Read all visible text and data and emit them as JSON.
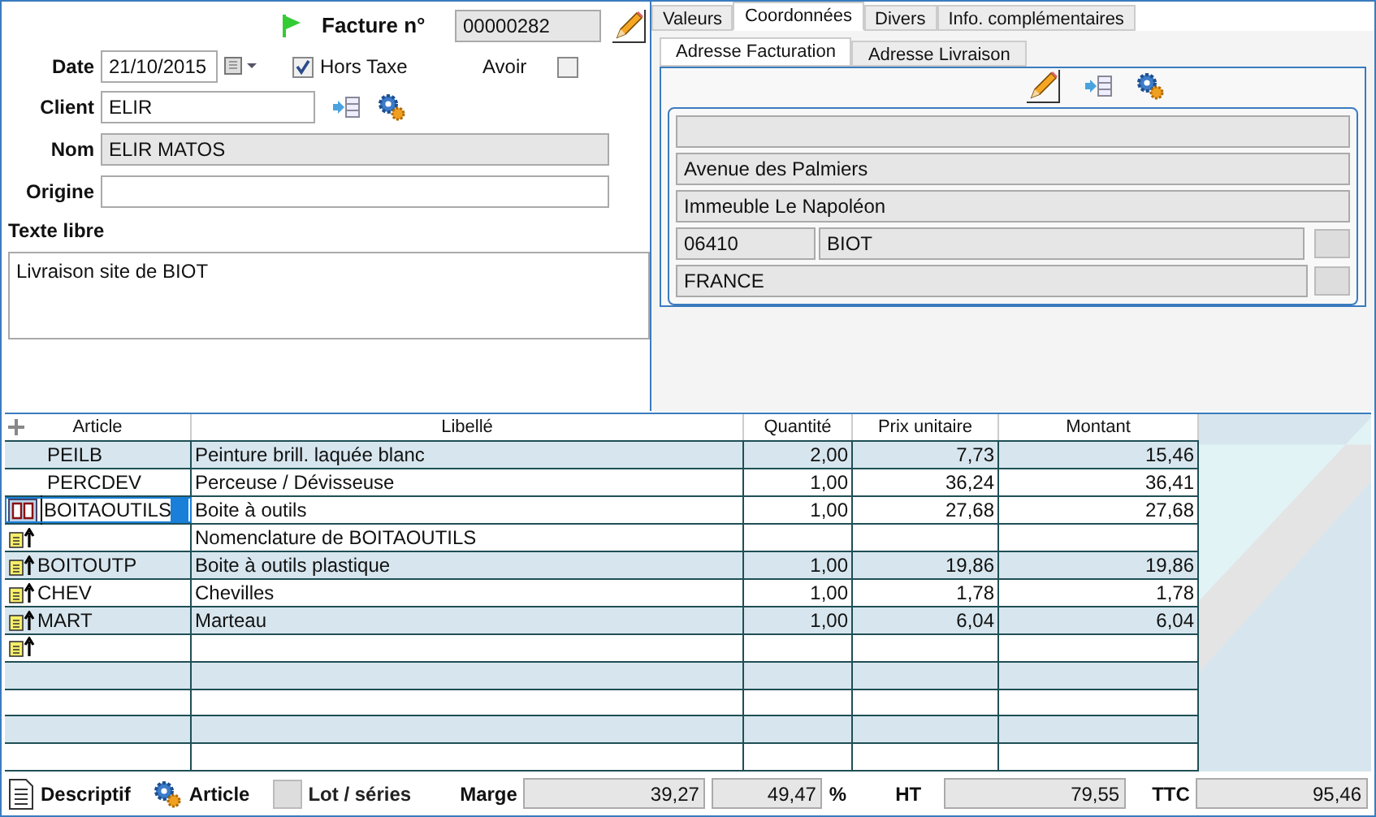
{
  "header": {
    "invoice_label": "Facture n°",
    "invoice_number": "00000282",
    "date_label": "Date",
    "date": "21/10/2015",
    "hors_taxe": {
      "label": "Hors Taxe",
      "checked": true
    },
    "avoir": {
      "label": "Avoir",
      "checked": false
    },
    "client_label": "Client",
    "client": "ELIR",
    "nom_label": "Nom",
    "nom": "ELIR MATOS",
    "origine_label": "Origine",
    "texte_label": "Texte libre",
    "texte": "Livraison site de BIOT"
  },
  "tabs": [
    {
      "label": "Valeurs",
      "selected": false
    },
    {
      "label": "Coordonnées",
      "selected": true
    },
    {
      "label": "Divers",
      "selected": false
    },
    {
      "label": "Info. complémentaires",
      "selected": false
    }
  ],
  "subtabs": [
    {
      "label": "Adresse Facturation",
      "selected": true
    },
    {
      "label": "Adresse Livraison",
      "selected": false
    }
  ],
  "address": {
    "line_2": "Avenue des Palmiers",
    "line_3": "Immeuble Le Napoléon",
    "postcode": "06410",
    "city": "BIOT",
    "country": "FRANCE"
  },
  "table": {
    "columns": [
      "Article",
      "Libellé",
      "Quantité",
      "Prix unitaire",
      "Montant"
    ],
    "rows": [
      {
        "kind": "line",
        "selected": false,
        "article": "PEILB",
        "libelle": "Peinture brill. laquée blanc",
        "quantite": "2,00",
        "prix": "7,73",
        "montant": "15,46"
      },
      {
        "kind": "line",
        "selected": false,
        "article": "PERCDEV",
        "libelle": "Perceuse / Dévisseuse",
        "quantite": "1,00",
        "prix": "36,24",
        "montant": "36,41"
      },
      {
        "kind": "kit",
        "selected": true,
        "article": "BOITAOUTILS",
        "libelle": "Boite à outils",
        "quantite": "1,00",
        "prix": "27,68",
        "montant": "27,68"
      },
      {
        "kind": "component",
        "selected": false,
        "libelle": "Nomenclature de BOITAOUTILS"
      },
      {
        "kind": "component",
        "selected": false,
        "article": "BOITOUTP",
        "libelle": "Boite à outils plastique",
        "quantite": "1,00",
        "prix": "19,86",
        "montant": "19,86"
      },
      {
        "kind": "component",
        "selected": false,
        "article": "CHEV",
        "libelle": "Chevilles",
        "quantite": "1,00",
        "prix": "1,78",
        "montant": "1,78"
      },
      {
        "kind": "component",
        "selected": false,
        "article": "MART",
        "libelle": "Marteau",
        "quantite": "1,00",
        "prix": "6,04",
        "montant": "6,04"
      },
      {
        "kind": "component",
        "selected": false
      }
    ]
  },
  "footer": {
    "descriptif": "Descriptif",
    "article": "Article",
    "lot": {
      "label": "Lot / séries",
      "disabled": true
    },
    "marge_label": "Marge",
    "marge": "39,27",
    "marge_pct": "49,47",
    "pct": "%",
    "ht_label": "HT",
    "ht": "79,55",
    "ttc_label": "TTC",
    "ttc": "95,46"
  }
}
